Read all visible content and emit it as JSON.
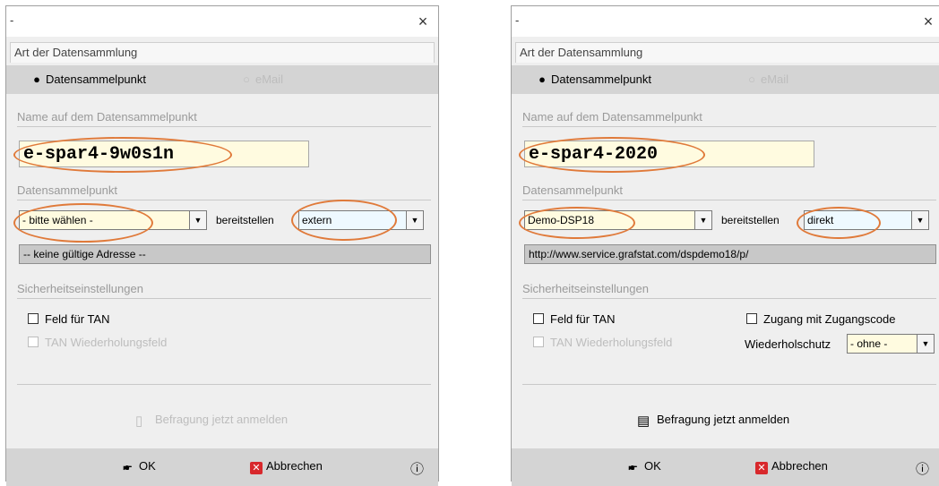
{
  "dialogs": [
    {
      "title_dash": "-",
      "close": "×",
      "section_title": "Art der Datensammlung",
      "radio_dsp": "Datensammelpunkt",
      "radio_email": "eMail",
      "name_group": "Name auf dem Datensammelpunkt",
      "name_value": "e-spar4-9w0s1n",
      "dsp_group": "Datensammelpunkt",
      "dsp_select": "- bitte wählen -",
      "provide_label": "bereitstellen",
      "provide_select": "extern",
      "address": "-- keine gültige Adresse --",
      "security_group": "Sicherheitseinstellungen",
      "tan_field": "Feld für TAN",
      "tan_repeat": "TAN Wiederholungsfeld",
      "register": "Befragung jetzt anmelden",
      "ok": "OK",
      "cancel": "Abbrechen",
      "help": "?"
    },
    {
      "title_dash": "-",
      "close": "×",
      "section_title": "Art der Datensammlung",
      "radio_dsp": "Datensammelpunkt",
      "radio_email": "eMail",
      "name_group": "Name auf dem Datensammelpunkt",
      "name_value": "e-spar4-2020",
      "dsp_group": "Datensammelpunkt",
      "dsp_select": "Demo-DSP18",
      "provide_label": "bereitstellen",
      "provide_select": "direkt",
      "address": "http://www.service.grafstat.com/dspdemo18/p/",
      "security_group": "Sicherheitseinstellungen",
      "tan_field": "Feld für TAN",
      "tan_repeat": "TAN Wiederholungsfeld",
      "access_code": "Zugang mit Zugangscode",
      "repeat_protect_label": "Wiederholschutz",
      "repeat_protect_select": "- ohne -",
      "register": "Befragung jetzt anmelden",
      "ok": "OK",
      "cancel": "Abbrechen",
      "help": "?"
    }
  ],
  "colors": {
    "highlight": "#e07a3a",
    "input_bg": "#fffbe0",
    "band_bg": "#d4d4d4"
  }
}
